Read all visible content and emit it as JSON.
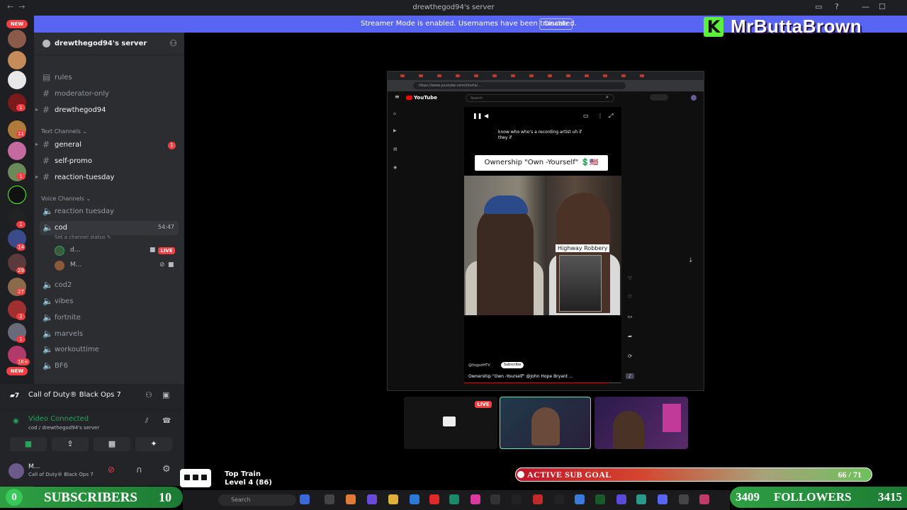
{
  "window": {
    "title": "drewthegod94's server"
  },
  "banner": {
    "text": "Streamer Mode is enabled. Usernames have been truncated.",
    "button": "Disable"
  },
  "overlay_brand": {
    "logo_letter": "K",
    "name": "MrButtaBrown"
  },
  "server_rail": {
    "new_label": "NEW",
    "badges": [
      "13",
      "1",
      "1",
      "11",
      "1",
      "1",
      "14",
      "29",
      "27",
      "2",
      "1",
      "1K+"
    ]
  },
  "server": {
    "name": "drewthegod94's server"
  },
  "channels": {
    "top": [
      {
        "name": "rules"
      },
      {
        "name": "moderator-only"
      },
      {
        "name": "drewthegod94"
      }
    ],
    "text_category": "Text Channels",
    "text": [
      {
        "name": "general",
        "badge": "1"
      },
      {
        "name": "self-promo"
      },
      {
        "name": "reaction-tuesday"
      }
    ],
    "voice_category": "Voice Channels",
    "voice": [
      {
        "name": "reaction tuesday"
      },
      {
        "name": "cod",
        "time": "54:47",
        "status": "Set a channel status"
      },
      {
        "name": "cod2"
      },
      {
        "name": "vibes"
      },
      {
        "name": "fortnite"
      },
      {
        "name": "marvels"
      },
      {
        "name": "workouttime"
      },
      {
        "name": "BF6"
      }
    ],
    "voice_users": [
      {
        "name": "d...",
        "live": "LIVE"
      },
      {
        "name": "M..."
      }
    ]
  },
  "game_activity": {
    "title": "Call of Duty® Black Ops 7"
  },
  "voice_status": {
    "connected": "Video Connected",
    "location": "cod / drewthegod94's server"
  },
  "user": {
    "name": "M...",
    "status": "Call of Duty® Black Ops 7"
  },
  "stream_window": {
    "url": "https://www.youtube.com/shorts/...",
    "yt_brand": "YouTube",
    "search_placeholder": "Search",
    "caption": "know who who's a recording artist uh if they if",
    "title_card": "Ownership \"Own -Yourself\" 💲🇺🇸",
    "overlay_label": "Highway Robbery",
    "channel": "@ItsgodHTV",
    "subscribe": "Subscribe",
    "video_title": "Ownership \"Own -Yourself\" @John Hope Bryant ...",
    "progress": 0.92
  },
  "cams": {
    "live_label": "LIVE"
  },
  "sub_goal": {
    "label": "ACTIVE SUB GOAL",
    "count": "66 / 71",
    "progress": 0.93
  },
  "subscribers": {
    "left": "0",
    "label": "SUBSCRIBERS",
    "right": "10"
  },
  "followers": {
    "left": "3409",
    "label": "FOLLOWERS",
    "right": "3415"
  },
  "top_train": {
    "title": "Top Train",
    "level": "Level 4  (86)"
  },
  "taskbar": {
    "search": "Search"
  },
  "colors": {
    "accent": "#5865f2",
    "green": "#2ea043",
    "red": "#f23f43"
  }
}
